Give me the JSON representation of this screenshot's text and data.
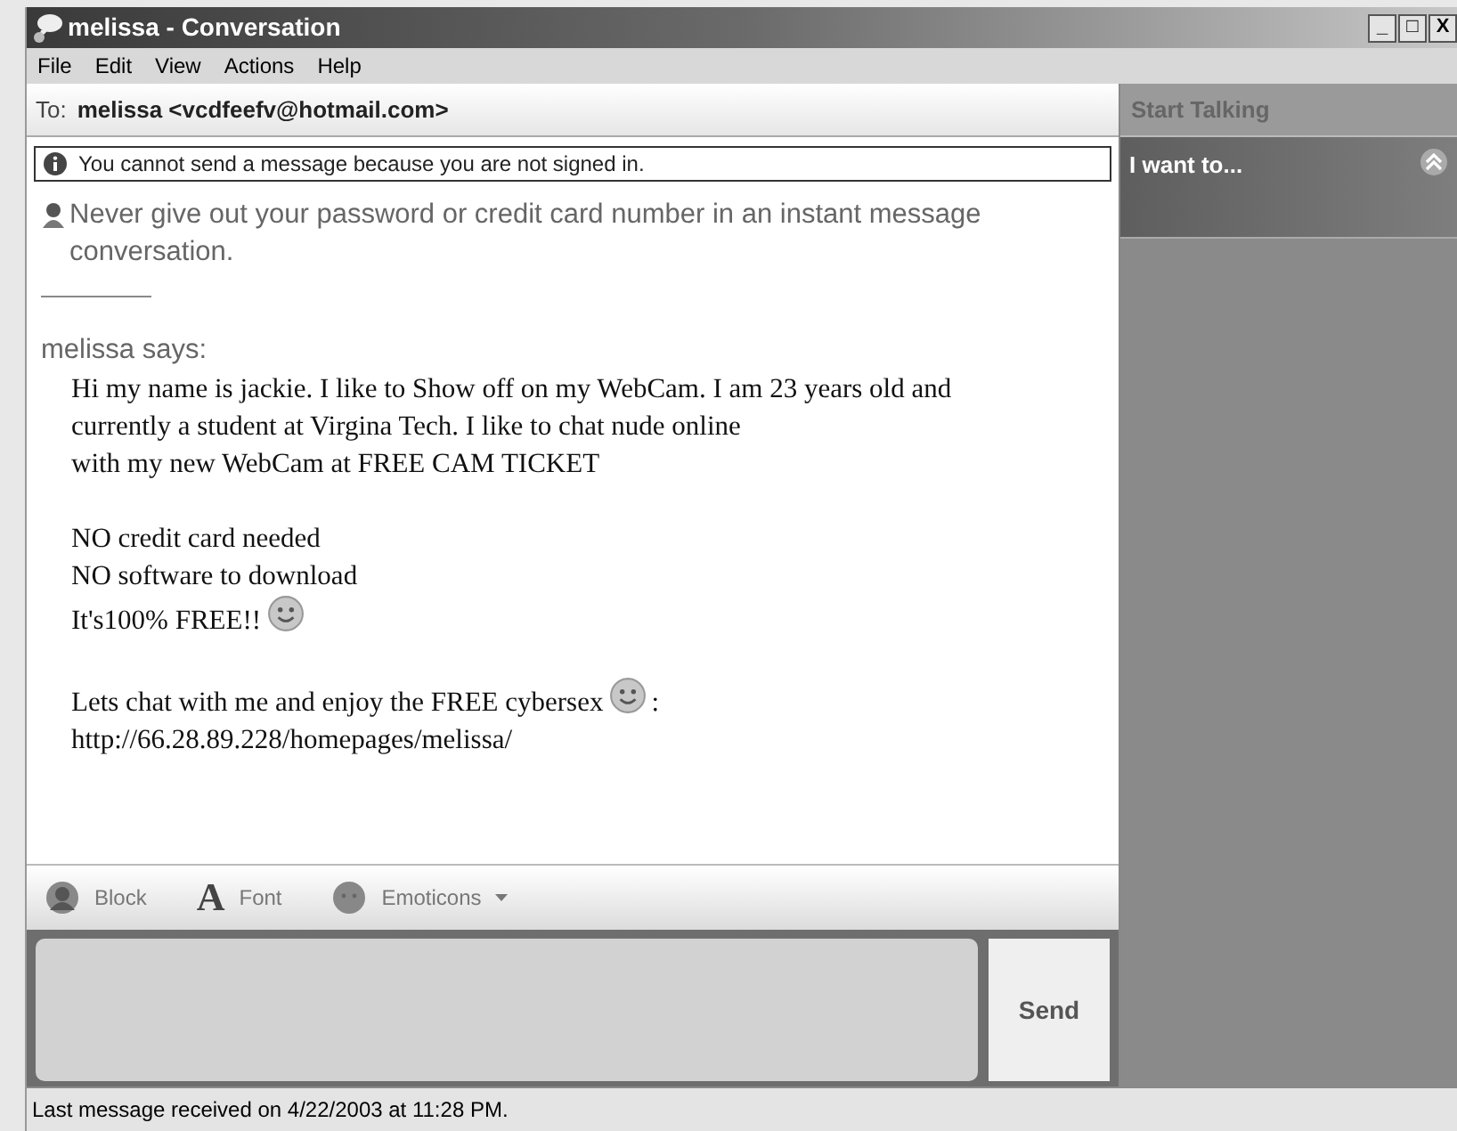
{
  "window": {
    "title": "melissa - Conversation",
    "controls": [
      "_",
      "□",
      "X"
    ]
  },
  "menu": [
    "File",
    "Edit",
    "View",
    "Actions",
    "Help"
  ],
  "to": {
    "label": "To:",
    "contact": "melissa <vcdfeefv@hotmail.com>"
  },
  "notice": "You cannot send a message because you are not signed in.",
  "warning": "Never give out your password or credit card number in an instant message conversation.",
  "sender": "melissa says:",
  "paragraphs": [
    [
      {
        "text": "Hi my name is jackie. I like to Show off on my WebCam. I am 23 years old and currently a student at Virgina Tech. I like to chat nude online",
        "smiley": false
      },
      {
        "text": "with my new WebCam at FREE CAM TICKET",
        "smiley": false
      }
    ],
    [
      {
        "text": "NO credit card needed",
        "smiley": false
      },
      {
        "text": "NO software to download",
        "smiley": false
      },
      {
        "text": "It's100% FREE!!",
        "smiley": true
      }
    ],
    [
      {
        "text": "Lets chat with me and enjoy the FREE cybersex",
        "smiley": true,
        "after": ":"
      },
      {
        "text": "http://66.28.89.228/homepages/melissa/",
        "smiley": false
      }
    ]
  ],
  "toolbar": [
    {
      "kind": "block",
      "label": "Block"
    },
    {
      "kind": "font",
      "label": "Font",
      "glyph": "A"
    },
    {
      "kind": "emoticons",
      "label": "Emoticons",
      "dropdown": true
    }
  ],
  "send_button": "Send",
  "side_panel": {
    "header": "Start Talking",
    "section": {
      "title": "I want to...",
      "expanded": true
    }
  },
  "status_bar": "Last message received on 4/22/2003 at 11:28 PM."
}
